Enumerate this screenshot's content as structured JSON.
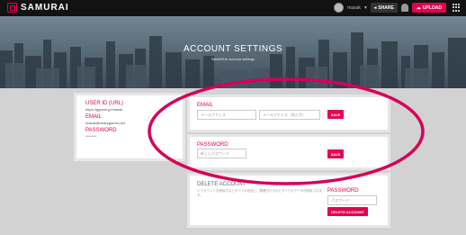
{
  "brand": {
    "name": "SAMURAI"
  },
  "nav": {
    "user_name": "masak",
    "share_label": "SHARE",
    "upload_label": "UPLOAD"
  },
  "hero": {
    "title": "ACCOUNT SETTINGS",
    "subtitle": "SAMURAI account settings"
  },
  "profile": {
    "user_id_label": "USER ID (URL)",
    "user_id_value": "https://ggame.jp/masak",
    "email_label": "EMAIL",
    "email_value": "masak@sharpgames.biz",
    "password_label": "PASSWORD",
    "password_value": "********"
  },
  "email_section": {
    "label": "EMAIL",
    "new_email_placeholder": "メールアドレス",
    "confirm_email_placeholder": "メールアドレス（再入力）",
    "save_label": "SAVE"
  },
  "password_section": {
    "label": "PASSWORD",
    "new_password_placeholder": "新しいパスワード",
    "save_label": "SAVE"
  },
  "delete_section": {
    "title": "DELETE ACCOUNT",
    "note": "※アカウントを削除するとすべての作品と、関連付けられたすべてのデータが削除されます。",
    "password_label": "PASSWORD",
    "password_placeholder": "パスワード",
    "button_label": "DELETE ACCOUNT"
  },
  "colors": {
    "accent": "#e3004f",
    "nav_bg": "#121212",
    "page_bg": "#d2d2d2",
    "annotation": "#d6005a"
  }
}
